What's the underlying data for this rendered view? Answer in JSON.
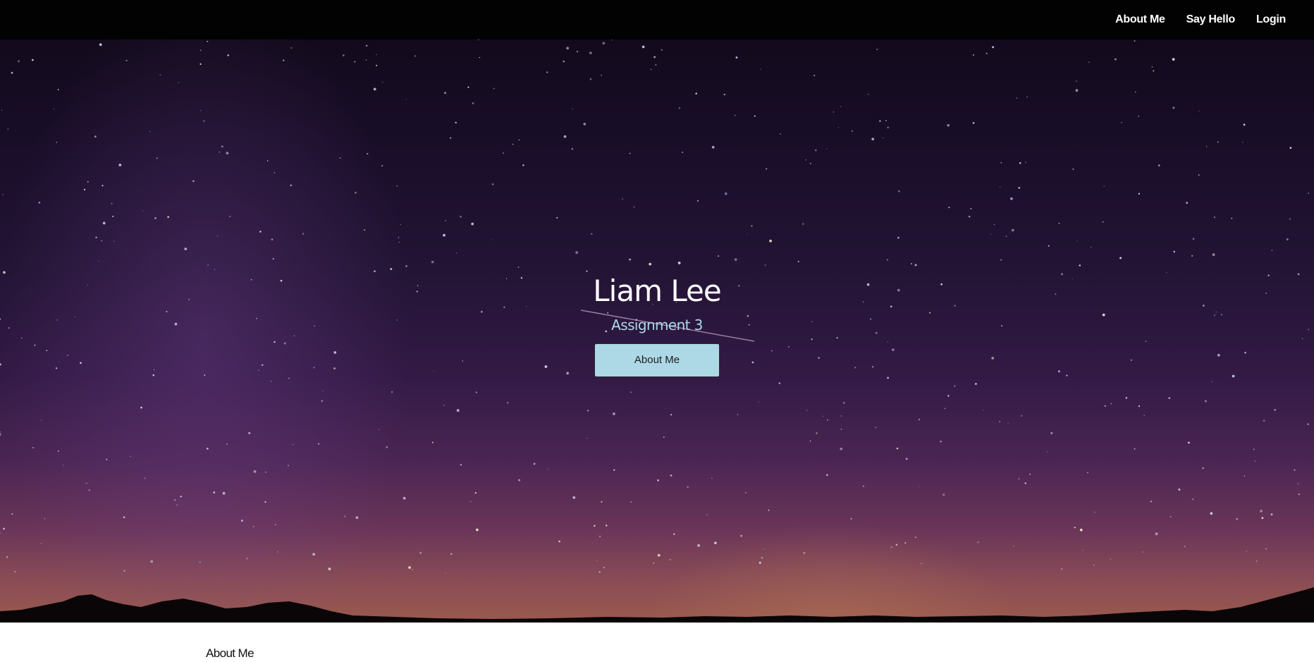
{
  "navbar": {
    "links": [
      {
        "label": "About Me"
      },
      {
        "label": "Say Hello"
      },
      {
        "label": "Login"
      }
    ]
  },
  "hero": {
    "title": "Liam Lee",
    "subtitle": "Assignment 3",
    "button_label": "About Me"
  },
  "about": {
    "heading": "About Me"
  },
  "colors": {
    "navbar_bg": "#020202",
    "accent": "#add8e6",
    "hero_text": "#ffffff"
  }
}
